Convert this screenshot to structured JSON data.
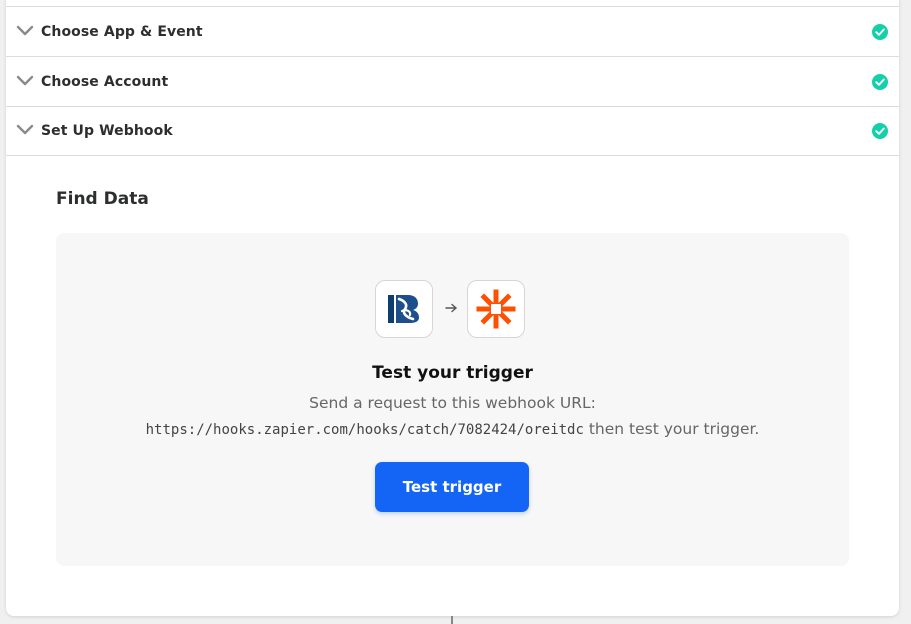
{
  "steps": [
    {
      "label": "Choose App & Event",
      "status": "complete"
    },
    {
      "label": "Choose Account",
      "status": "complete"
    },
    {
      "label": "Set Up Webhook",
      "status": "complete"
    }
  ],
  "find_data": {
    "title": "Find Data",
    "test": {
      "heading": "Test your trigger",
      "description": "Send a request to this webhook URL:",
      "url": "https://hooks.zapier.com/hooks/catch/7082424/oreitdc",
      "url_suffix": " then test your trigger.",
      "button_label": "Test trigger"
    },
    "source_app_icon": "app-logo-icon",
    "target_app_icon": "zapier-logo-icon"
  },
  "colors": {
    "accent": "#1464f6",
    "success": "#13d0ab",
    "zapier_orange": "#ff4f00"
  }
}
